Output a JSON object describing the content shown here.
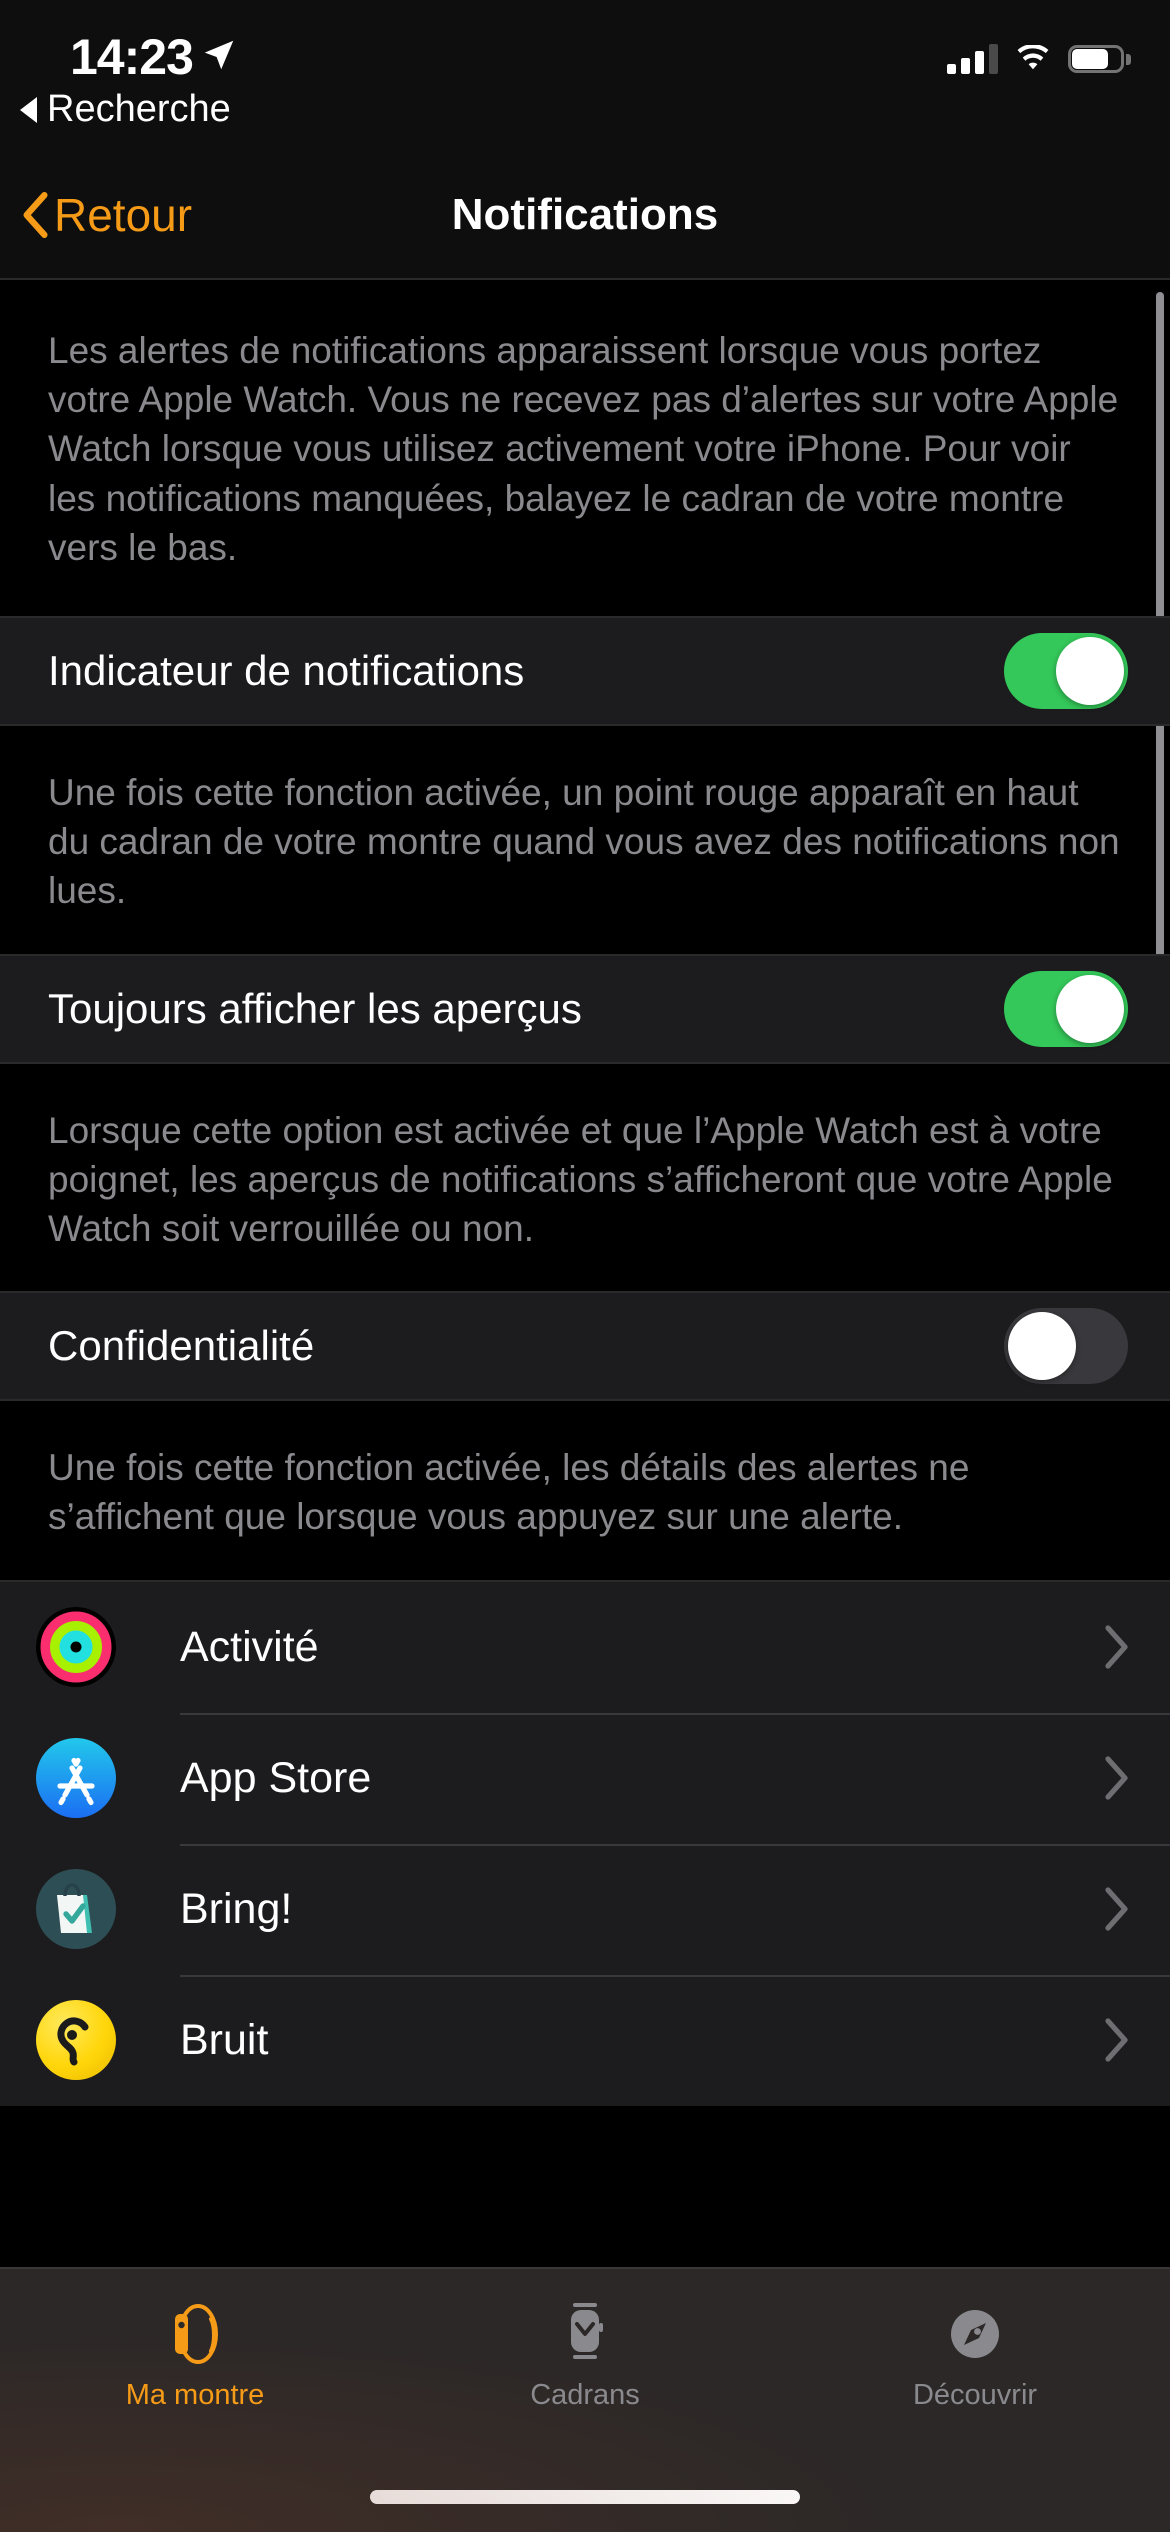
{
  "status_bar": {
    "time": "14:23",
    "location_icon": "location-arrow-icon",
    "back_link_label": "Recherche",
    "back_link_icon": "triangle-left-icon",
    "cellular_icon": "cellular-signal-icon",
    "cellular_bars_filled": 3,
    "cellular_bars_total": 4,
    "wifi_icon": "wifi-icon",
    "battery_icon": "battery-icon",
    "battery_level_percent": 80
  },
  "nav_bar": {
    "back_label": "Retour",
    "back_icon": "chevron-left-icon",
    "title": "Notifications",
    "accent_color": "#F59B17"
  },
  "content": {
    "intro_footer": "Les alertes de notifications apparaissent lorsque vous portez votre Apple Watch. Vous ne recevez pas d’alertes sur votre Apple Watch lorsque vous utilisez activement votre iPhone. Pour voir les notifications manquées, balayez le cadran de votre montre vers le bas.",
    "toggles": [
      {
        "label": "Indicateur de notifications",
        "state": "on",
        "footer": "Une fois cette fonction activée, un point rouge apparaît en haut du cadran de votre montre quand vous avez des notifications non lues."
      },
      {
        "label": "Toujours afficher les aperçus",
        "state": "on",
        "footer": "Lorsque cette option est activée et que l’Apple Watch est à votre poignet, les aperçus de notifications s’afficheront que votre Apple Watch soit verrouillée ou non."
      },
      {
        "label": "Confidentialité",
        "state": "off",
        "footer": "Une fois cette fonction activée, les détails des alertes ne s’affichent que lorsque vous appuyez sur une alerte."
      }
    ],
    "apps": [
      {
        "name": "Activité",
        "icon": "activity-rings-icon",
        "chevron": "chevron-right-icon"
      },
      {
        "name": "App Store",
        "icon": "app-store-icon",
        "chevron": "chevron-right-icon"
      },
      {
        "name": "Bring!",
        "icon": "bring-shopping-bag-icon",
        "chevron": "chevron-right-icon"
      },
      {
        "name": "Bruit",
        "icon": "noise-ear-icon",
        "chevron": "chevron-right-icon"
      }
    ]
  },
  "tab_bar": {
    "items": [
      {
        "label": "Ma montre",
        "icon": "watch-side-icon",
        "active": true
      },
      {
        "label": "Cadrans",
        "icon": "watch-face-icon",
        "active": false
      },
      {
        "label": "Découvrir",
        "icon": "compass-icon",
        "active": false
      }
    ],
    "active_color": "#F59B17",
    "inactive_color": "#8A8A8E"
  },
  "colors": {
    "toggle_on": "#34C759",
    "toggle_off": "#39393D",
    "row_background": "#1C1C1E",
    "page_background": "#000000",
    "footer_text": "#8A8A8E"
  }
}
